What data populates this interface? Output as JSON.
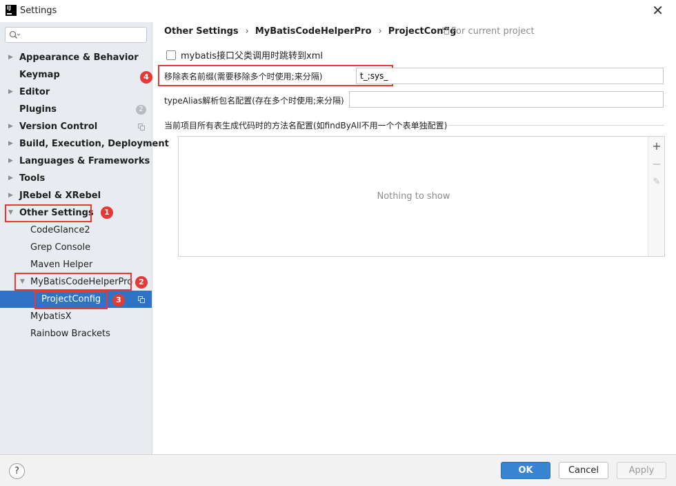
{
  "window": {
    "title": "Settings",
    "close_glyph": "✕"
  },
  "search": {
    "placeholder": "",
    "value": ""
  },
  "sidebar": {
    "items": [
      {
        "label": "Appearance & Behavior",
        "bold": true,
        "arrow": "▶"
      },
      {
        "label": "Keymap",
        "bold": true
      },
      {
        "label": "Editor",
        "bold": true,
        "arrow": "▶"
      },
      {
        "label": "Plugins",
        "bold": true,
        "badge": "2"
      },
      {
        "label": "Version Control",
        "bold": true,
        "arrow": "▶"
      },
      {
        "label": "Build, Execution, Deployment",
        "bold": true,
        "arrow": "▶"
      },
      {
        "label": "Languages & Frameworks",
        "bold": true,
        "arrow": "▶"
      },
      {
        "label": "Tools",
        "bold": true,
        "arrow": "▶"
      },
      {
        "label": "JRebel & XRebel",
        "bold": true,
        "arrow": "▶"
      },
      {
        "label": "Other Settings",
        "bold": true,
        "arrow": "▼"
      },
      {
        "label": "CodeGlance2"
      },
      {
        "label": "Grep Console"
      },
      {
        "label": "Maven Helper"
      },
      {
        "label": "MyBatisCodeHelperPro",
        "arrow": "▼"
      },
      {
        "label": "ProjectConfig",
        "selected": true
      },
      {
        "label": "MybatisX"
      },
      {
        "label": "Rainbow Brackets"
      }
    ]
  },
  "annotations": [
    "1",
    "2",
    "3",
    "4"
  ],
  "breadcrumb": [
    "Other Settings",
    "MyBatisCodeHelperPro",
    "ProjectConfig"
  ],
  "breadcrumb_sep": "›",
  "scope_label": "For current project",
  "main": {
    "checkbox_label": "mybatis接口父类调用时跳转到xml",
    "remove_prefix_label": "移除表名前缀(需要移除多个时使用;来分隔)",
    "remove_prefix_value": "t_;sys_",
    "type_alias_label": "typeAlias解析包名配置(存在多个时使用;来分隔)",
    "type_alias_value": "",
    "section_title": "当前项目所有表生成代码时的方法名配置(如findByAll不用一个个表单独配置)",
    "table_empty": "Nothing to show",
    "tool_add": "+",
    "tool_remove": "−",
    "tool_edit": "✎"
  },
  "footer": {
    "help": "?",
    "ok": "OK",
    "cancel": "Cancel",
    "apply": "Apply"
  },
  "colors": {
    "selection": "#2f74c4",
    "annotation": "#e53935",
    "ok_button": "#3a85d2"
  }
}
